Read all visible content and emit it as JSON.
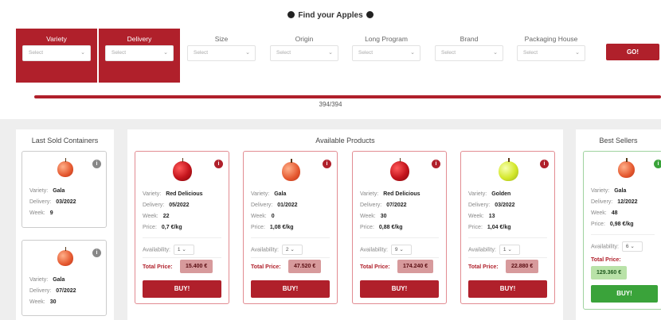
{
  "header": {
    "title": "Find your Apples"
  },
  "filters": [
    {
      "label": "Variety",
      "placeholder": "Select",
      "active": true
    },
    {
      "label": "Delivery",
      "placeholder": "Select",
      "active": true
    },
    {
      "label": "Size",
      "placeholder": "Select",
      "active": false
    },
    {
      "label": "Origin",
      "placeholder": "Select",
      "active": false
    },
    {
      "label": "Long Program",
      "placeholder": "Select",
      "active": false
    },
    {
      "label": "Brand",
      "placeholder": "Select",
      "active": false
    },
    {
      "label": "Packaging House",
      "placeholder": "Select",
      "active": false
    }
  ],
  "go_label": "GO!",
  "progress": {
    "text": "394/394",
    "fraction": 1.0
  },
  "last_sold": {
    "title": "Last Sold Containers",
    "items": [
      {
        "variety_label": "Variety:",
        "variety": "Gala",
        "delivery_label": "Delivery:",
        "delivery": "03/2022",
        "week_label": "Week:",
        "week": "9",
        "apple": "orange"
      },
      {
        "variety_label": "Variety:",
        "variety": "Gala",
        "delivery_label": "Delivery:",
        "delivery": "07/2022",
        "week_label": "Week:",
        "week": "30",
        "apple": "orange"
      }
    ]
  },
  "available": {
    "title": "Available Products",
    "items": [
      {
        "variety": "Red Delicious",
        "delivery": "05/2022",
        "week": "22",
        "price": "0,7 €/kg",
        "availability": "1",
        "total": "15.400 €",
        "apple": "red"
      },
      {
        "variety": "Gala",
        "delivery": "01/2022",
        "week": "0",
        "price": "1,08 €/kg",
        "availability": "2",
        "total": "47.520 €",
        "apple": "orange"
      },
      {
        "variety": "Red Delicious",
        "delivery": "07/2022",
        "week": "30",
        "price": "0,88 €/kg",
        "availability": "9",
        "total": "174.240 €",
        "apple": "red"
      },
      {
        "variety": "Golden",
        "delivery": "03/2022",
        "week": "13",
        "price": "1,04 €/kg",
        "availability": "1",
        "total": "22.880 €",
        "apple": "yellow"
      }
    ]
  },
  "best_sellers": {
    "title": "Best Sellers",
    "item": {
      "variety": "Gala",
      "delivery": "12/2022",
      "week": "48",
      "price": "0,98 €/kg",
      "availability": "6",
      "total": "129.360 €",
      "apple": "orange"
    }
  },
  "labels": {
    "variety": "Variety:",
    "delivery": "Delivery:",
    "week": "Week:",
    "price": "Price:",
    "availability": "Availability:",
    "total_price": "Total Price:",
    "buy": "BUY!"
  },
  "colors": {
    "accent": "#b0202b",
    "success": "#3aa33a",
    "badge": "#d79a9c"
  }
}
